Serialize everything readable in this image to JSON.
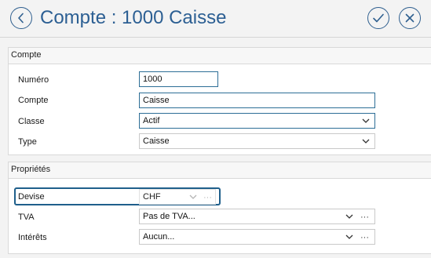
{
  "header": {
    "title": "Compte : 1000 Caisse"
  },
  "sections": {
    "compte": {
      "title": "Compte",
      "numero": {
        "label": "Numéro",
        "value": "1000"
      },
      "compte": {
        "label": "Compte",
        "value": "Caisse"
      },
      "classe": {
        "label": "Classe",
        "value": "Actif"
      },
      "type": {
        "label": "Type",
        "value": "Caisse"
      }
    },
    "proprietes": {
      "title": "Propriétés",
      "devise": {
        "label": "Devise",
        "value": "CHF",
        "more": "···"
      },
      "tva": {
        "label": "TVA",
        "value": "Pas de TVA...",
        "more": "···"
      },
      "interets": {
        "label": "Intérêts",
        "value": "Aucun...",
        "more": "···"
      }
    }
  },
  "colors": {
    "accent": "#2c5f93",
    "focus_border": "#1f5f8b"
  }
}
